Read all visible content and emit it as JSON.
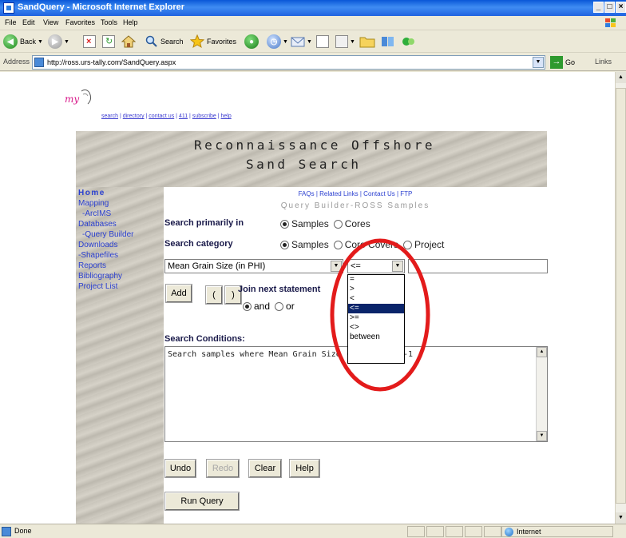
{
  "window": {
    "title": "SandQuery - Microsoft Internet Explorer",
    "buttons": {
      "minimize": "_",
      "maximize": "□",
      "close": "×"
    }
  },
  "menu": [
    "File",
    "Edit",
    "View",
    "Favorites",
    "Tools",
    "Help"
  ],
  "toolbar": {
    "back": "Back",
    "search": "Search",
    "favorites": "Favorites"
  },
  "address": {
    "label": "Address",
    "url": "http://ross.urs-tally.com/SandQuery.aspx",
    "go": "Go",
    "links": "Links"
  },
  "status": {
    "text": "Done",
    "zone": "Internet"
  },
  "page": {
    "top_links": [
      "search",
      "directory",
      "contact us",
      "411",
      "subscribe",
      "help"
    ],
    "banner": {
      "line1": "Reconnaissance Offshore",
      "line2": "Sand Search"
    },
    "nav": [
      "Home",
      "Mapping",
      "-ArcIMS",
      "Databases",
      "-Query Builder",
      "Downloads",
      "-Shapefiles",
      "Reports",
      "Bibliography",
      "Project List"
    ],
    "help_links": [
      "FAQs",
      "Related Links",
      "Contact Us",
      "FTP"
    ],
    "query_builder_title": "Query Builder-ROSS Samples",
    "search_primarily_in": {
      "label": "Search primarily in",
      "options": [
        "Samples",
        "Cores"
      ],
      "selected": "Samples"
    },
    "search_category": {
      "label": "Search category",
      "options": [
        "Samples",
        "Core Covers",
        "Project"
      ],
      "selected": "Samples"
    },
    "field_select": "Mean Grain Size (in PHI)",
    "operator_select": "<=",
    "operator_options": [
      "=",
      ">",
      "<",
      "<=",
      ">=",
      "<>",
      "between"
    ],
    "operator_highlighted": "<=",
    "value_input": "",
    "join": {
      "label": "Join next statement",
      "options": [
        "and",
        "or"
      ],
      "selected": "and"
    },
    "buttons": {
      "add": "Add",
      "open_paren": "(",
      "close_paren": ")",
      "undo": "Undo",
      "redo": "Redo",
      "clear": "Clear",
      "help": "Help",
      "run": "Run Query"
    },
    "conditions_label": "Search Conditions:",
    "conditions_text": "Search samples where Mean Grain Size (in PHI) >= -1"
  },
  "colors": {
    "highlight_ring": "#e31b1b",
    "selection": "#0a246a",
    "link": "#2a3fd0"
  }
}
